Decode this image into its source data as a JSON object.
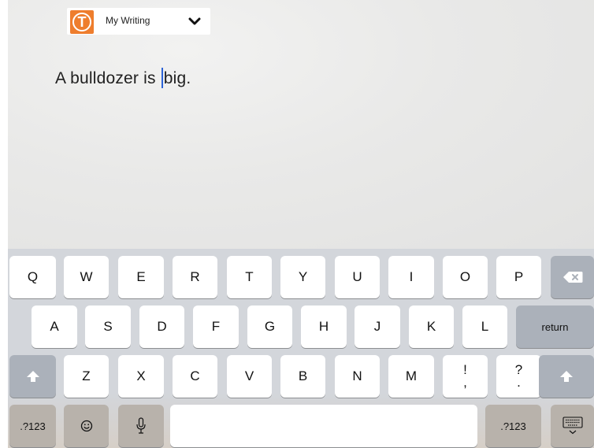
{
  "app": {
    "document_title": "My Writing",
    "logo_letter": "T",
    "logo_color": "#ee7d2d"
  },
  "editor": {
    "text_before_cursor": "A bulldozer is ",
    "text_after_cursor": "big.",
    "cursor_color": "#2c63d6"
  },
  "keyboard": {
    "row1": [
      "Q",
      "W",
      "E",
      "R",
      "T",
      "Y",
      "U",
      "I",
      "O",
      "P"
    ],
    "row2": [
      "A",
      "S",
      "D",
      "F",
      "G",
      "H",
      "J",
      "K",
      "L"
    ],
    "row3": [
      "Z",
      "X",
      "C",
      "V",
      "B",
      "N",
      "M"
    ],
    "punct1": {
      "top": "!",
      "bottom": ","
    },
    "punct2": {
      "top": "?",
      "bottom": "."
    },
    "return_label": "return",
    "numbers_label": ".?123",
    "icons": {
      "backspace": "backspace-icon",
      "shift": "shift-arrow-icon",
      "emoji": "emoji-icon",
      "dictation": "microphone-icon",
      "hide_keyboard": "keyboard-hide-icon"
    }
  }
}
